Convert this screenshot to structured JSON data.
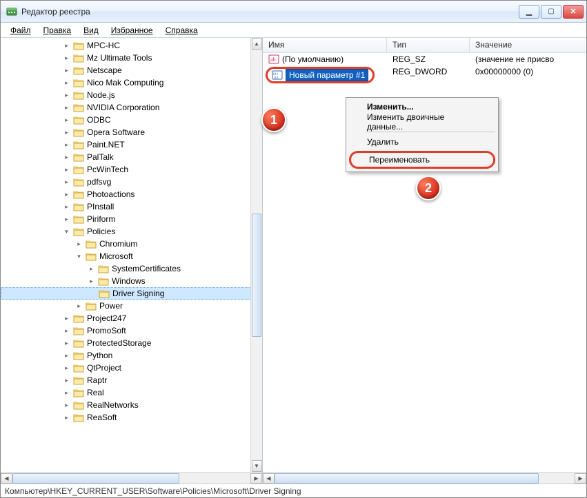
{
  "window": {
    "title": "Редактор реестра"
  },
  "menu": {
    "file": "Файл",
    "edit": "Правка",
    "view": "Вид",
    "favorites": "Избранное",
    "help": "Справка"
  },
  "tree": {
    "items": [
      {
        "label": "MPC-HC",
        "depth": 1,
        "exp": "closed"
      },
      {
        "label": "Mz Ultimate Tools",
        "depth": 1,
        "exp": "closed"
      },
      {
        "label": "Netscape",
        "depth": 1,
        "exp": "closed"
      },
      {
        "label": "Nico Mak Computing",
        "depth": 1,
        "exp": "closed"
      },
      {
        "label": "Node.js",
        "depth": 1,
        "exp": "closed"
      },
      {
        "label": "NVIDIA Corporation",
        "depth": 1,
        "exp": "closed"
      },
      {
        "label": "ODBC",
        "depth": 1,
        "exp": "closed"
      },
      {
        "label": "Opera Software",
        "depth": 1,
        "exp": "closed"
      },
      {
        "label": "Paint.NET",
        "depth": 1,
        "exp": "closed"
      },
      {
        "label": "PalTalk",
        "depth": 1,
        "exp": "closed"
      },
      {
        "label": "PcWinTech",
        "depth": 1,
        "exp": "closed"
      },
      {
        "label": "pdfsvg",
        "depth": 1,
        "exp": "closed"
      },
      {
        "label": "Photoactions",
        "depth": 1,
        "exp": "closed"
      },
      {
        "label": "PInstall",
        "depth": 1,
        "exp": "closed"
      },
      {
        "label": "Piriform",
        "depth": 1,
        "exp": "closed"
      },
      {
        "label": "Policies",
        "depth": 1,
        "exp": "open"
      },
      {
        "label": "Chromium",
        "depth": 2,
        "exp": "closed"
      },
      {
        "label": "Microsoft",
        "depth": 2,
        "exp": "open"
      },
      {
        "label": "SystemCertificates",
        "depth": 3,
        "exp": "closed"
      },
      {
        "label": "Windows",
        "depth": 3,
        "exp": "closed"
      },
      {
        "label": "Driver Signing",
        "depth": 3,
        "exp": "none",
        "selected": true
      },
      {
        "label": "Power",
        "depth": 2,
        "exp": "closed"
      },
      {
        "label": "Project247",
        "depth": 1,
        "exp": "closed"
      },
      {
        "label": "PromoSoft",
        "depth": 1,
        "exp": "closed"
      },
      {
        "label": "ProtectedStorage",
        "depth": 1,
        "exp": "closed"
      },
      {
        "label": "Python",
        "depth": 1,
        "exp": "closed"
      },
      {
        "label": "QtProject",
        "depth": 1,
        "exp": "closed"
      },
      {
        "label": "Raptr",
        "depth": 1,
        "exp": "closed"
      },
      {
        "label": "Real",
        "depth": 1,
        "exp": "closed"
      },
      {
        "label": "RealNetworks",
        "depth": 1,
        "exp": "closed"
      },
      {
        "label": "ReaSoft",
        "depth": 1,
        "exp": "closed"
      }
    ]
  },
  "list": {
    "columns": {
      "name": "Имя",
      "type": "Тип",
      "value": "Значение"
    },
    "rows": [
      {
        "name": "(По умолчанию)",
        "type": "REG_SZ",
        "value": "(значение не присво",
        "icon": "string"
      },
      {
        "name": "Новый параметр #1",
        "type": "REG_DWORD",
        "value": "0x00000000 (0)",
        "icon": "binary",
        "editing": true
      }
    ]
  },
  "context_menu": {
    "modify": "Изменить...",
    "modify_binary": "Изменить двоичные данные...",
    "delete": "Удалить",
    "rename": "Переименовать"
  },
  "badges": {
    "one": "1",
    "two": "2"
  },
  "statusbar": {
    "path": "Компьютер\\HKEY_CURRENT_USER\\Software\\Policies\\Microsoft\\Driver Signing"
  }
}
